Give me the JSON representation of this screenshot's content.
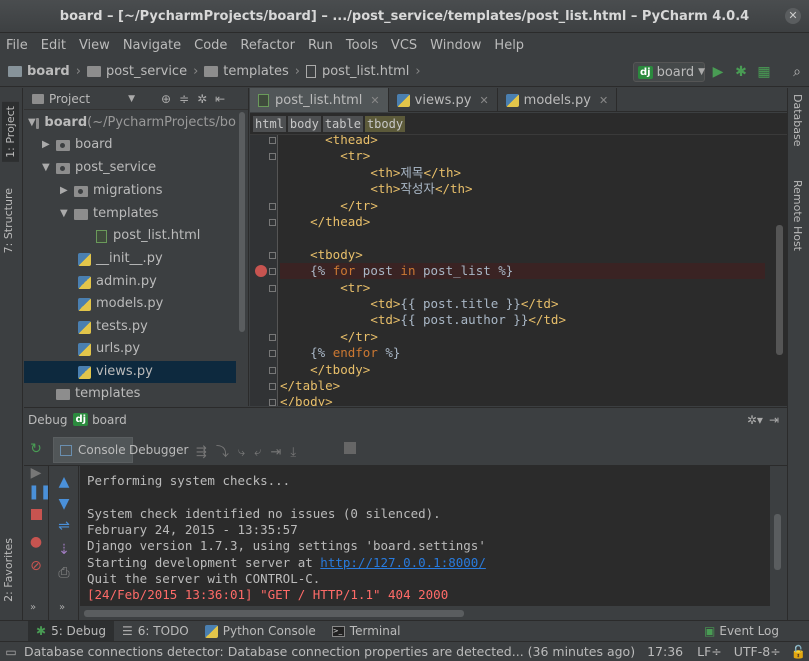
{
  "window": {
    "title": "board – [~/PycharmProjects/board] – .../post_service/templates/post_list.html – PyCharm 4.0.4"
  },
  "menu": [
    "File",
    "Edit",
    "View",
    "Navigate",
    "Code",
    "Refactor",
    "Run",
    "Tools",
    "VCS",
    "Window",
    "Help"
  ],
  "navbar": {
    "crumbs": [
      "board",
      "post_service",
      "templates",
      "post_list.html"
    ],
    "run_config": "board"
  },
  "project_panel": {
    "title": "Project",
    "tree": [
      {
        "label": "board",
        "suffix": " (~/PycharmProjects/bo",
        "bold": true
      },
      {
        "label": "board"
      },
      {
        "label": "post_service"
      },
      {
        "label": "migrations"
      },
      {
        "label": "templates"
      },
      {
        "label": "post_list.html"
      },
      {
        "label": "__init__.py"
      },
      {
        "label": "admin.py"
      },
      {
        "label": "models.py"
      },
      {
        "label": "tests.py"
      },
      {
        "label": "urls.py"
      },
      {
        "label": "views.py"
      },
      {
        "label": "templates"
      }
    ]
  },
  "editor": {
    "tabs": [
      "post_list.html",
      "views.py",
      "models.py"
    ],
    "breadcrumb": [
      "html",
      "body",
      "table",
      "tbody"
    ],
    "lines": [
      {
        "indent": "      ",
        "parts": [
          {
            "t": "<thead>",
            "c": "tag"
          }
        ]
      },
      {
        "indent": "        ",
        "parts": [
          {
            "t": "<tr>",
            "c": "tag"
          }
        ]
      },
      {
        "indent": "            ",
        "parts": [
          {
            "t": "<th>",
            "c": "tag"
          },
          {
            "t": "제목",
            "c": "txt"
          },
          {
            "t": "</th>",
            "c": "tag"
          }
        ]
      },
      {
        "indent": "            ",
        "parts": [
          {
            "t": "<th>",
            "c": "tag"
          },
          {
            "t": "작성자",
            "c": "txt"
          },
          {
            "t": "</th>",
            "c": "tag"
          }
        ]
      },
      {
        "indent": "        ",
        "parts": [
          {
            "t": "</tr>",
            "c": "tag"
          }
        ]
      },
      {
        "indent": "    ",
        "parts": [
          {
            "t": "</thead>",
            "c": "tag"
          }
        ]
      },
      {
        "indent": "",
        "parts": []
      },
      {
        "indent": "    ",
        "parts": [
          {
            "t": "<tbody>",
            "c": "tag"
          }
        ]
      },
      {
        "indent": "    ",
        "parts": [
          {
            "t": "{% ",
            "c": "txt"
          },
          {
            "t": "for",
            "c": "tpl"
          },
          {
            "t": " post ",
            "c": "txt"
          },
          {
            "t": "in",
            "c": "tpl"
          },
          {
            "t": " post_list %}",
            "c": "txt"
          }
        ]
      },
      {
        "indent": "        ",
        "parts": [
          {
            "t": "<tr>",
            "c": "tag"
          }
        ]
      },
      {
        "indent": "            ",
        "parts": [
          {
            "t": "<td>",
            "c": "tag"
          },
          {
            "t": "{{ post.title }}",
            "c": "txt"
          },
          {
            "t": "</td>",
            "c": "tag"
          }
        ]
      },
      {
        "indent": "            ",
        "parts": [
          {
            "t": "<td>",
            "c": "tag"
          },
          {
            "t": "{{ post.author }}",
            "c": "txt"
          },
          {
            "t": "</td>",
            "c": "tag"
          }
        ]
      },
      {
        "indent": "        ",
        "parts": [
          {
            "t": "</tr>",
            "c": "tag"
          }
        ]
      },
      {
        "indent": "    ",
        "parts": [
          {
            "t": "{% ",
            "c": "txt"
          },
          {
            "t": "endfor",
            "c": "tpl"
          },
          {
            "t": " %}",
            "c": "txt"
          }
        ]
      },
      {
        "indent": "    ",
        "parts": [
          {
            "t": "</tbody>",
            "c": "tag"
          }
        ]
      },
      {
        "indent": "",
        "parts": [
          {
            "t": "</table>",
            "c": "tag"
          }
        ]
      },
      {
        "indent": "",
        "parts": [
          {
            "t": "</body>",
            "c": "tag"
          }
        ]
      }
    ]
  },
  "debug": {
    "header_label": "Debug",
    "config": "board",
    "tabs": [
      "Console",
      "Debugger"
    ],
    "console_lines": [
      {
        "text": "Performing system checks...",
        "type": "normal"
      },
      {
        "text": "",
        "type": "normal"
      },
      {
        "text": "System check identified no issues (0 silenced).",
        "type": "normal"
      },
      {
        "text": "February 24, 2015 - 13:35:57",
        "type": "normal"
      },
      {
        "text": "Django version 1.7.3, using settings 'board.settings'",
        "type": "normal"
      },
      {
        "text": "Starting development server at ",
        "link": "http://127.0.0.1:8000/",
        "type": "normal"
      },
      {
        "text": "Quit the server with CONTROL-C.",
        "type": "normal"
      },
      {
        "text": "[24/Feb/2015 13:36:01] \"GET / HTTP/1.1\" 404 2000",
        "type": "err"
      }
    ]
  },
  "left_strip": {
    "project": "1: Project",
    "structure": "7: Structure",
    "favorites": "2: Favorites"
  },
  "right_strip": {
    "database": "Database",
    "remote": "Remote Host"
  },
  "bottom_tabs": [
    {
      "label": "5: Debug",
      "icon": "bug-icon"
    },
    {
      "label": "6: TODO",
      "icon": "todo-icon"
    },
    {
      "label": "Python Console",
      "icon": "python-icon"
    },
    {
      "label": "Terminal",
      "icon": "terminal-icon"
    }
  ],
  "event_log": "Event Log",
  "status": {
    "message": "Database connections detector: Database connection properties are detected... (36 minutes ago)",
    "position": "17:36",
    "line_sep": "LF÷",
    "encoding": "UTF-8÷"
  },
  "colors": {
    "accent_green": "#499c54",
    "breakpoint_red": "#c75450",
    "error_red": "#ff6b68",
    "link_blue": "#287bde",
    "tag_yellow": "#e8bf6a",
    "keyword_orange": "#cc7832"
  }
}
